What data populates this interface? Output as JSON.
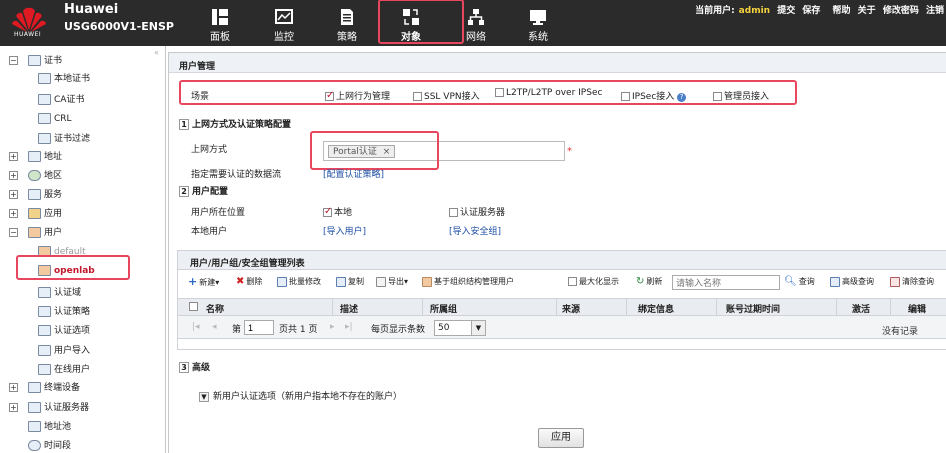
{
  "header": {
    "brand": "Huawei",
    "model": "USG6000V1-ENSP",
    "logo_text": "HUAWEI",
    "nav": [
      {
        "label": "面板",
        "icon": "dashboard-icon"
      },
      {
        "label": "监控",
        "icon": "monitor-icon"
      },
      {
        "label": "策略",
        "icon": "policy-icon"
      },
      {
        "label": "对象",
        "icon": "object-icon"
      },
      {
        "label": "网络",
        "icon": "network-icon"
      },
      {
        "label": "系统",
        "icon": "system-icon"
      }
    ],
    "current_user_label": "当前用户:",
    "current_user": "admin",
    "links": [
      "提交",
      "保存",
      "帮助",
      "关于",
      "修改密码",
      "注销"
    ]
  },
  "sidebar": {
    "items": [
      {
        "label": "证书",
        "expander": "−"
      },
      {
        "label": "本地证书"
      },
      {
        "label": "CA证书"
      },
      {
        "label": "CRL"
      },
      {
        "label": "证书过滤"
      },
      {
        "label": "地址",
        "expander": "+"
      },
      {
        "label": "地区",
        "expander": "+"
      },
      {
        "label": "服务",
        "expander": "+"
      },
      {
        "label": "应用",
        "expander": "+"
      },
      {
        "label": "用户",
        "expander": "−"
      },
      {
        "label": "default"
      },
      {
        "label": "openlab"
      },
      {
        "label": "认证域"
      },
      {
        "label": "认证策略"
      },
      {
        "label": "认证选项"
      },
      {
        "label": "用户导入"
      },
      {
        "label": "在线用户"
      },
      {
        "label": "终端设备",
        "expander": "+"
      },
      {
        "label": "认证服务器",
        "expander": "+"
      },
      {
        "label": "地址池"
      },
      {
        "label": "时间段"
      }
    ]
  },
  "main": {
    "title": "用户管理",
    "scene_label": "场景",
    "scene_options": [
      {
        "label": "上网行为管理",
        "checked": true
      },
      {
        "label": "SSL VPN接入",
        "checked": false
      },
      {
        "label": "L2TP/L2TP over IPSec",
        "checked": false
      },
      {
        "label": "IPSec接入",
        "checked": false
      },
      {
        "label": "管理员接入",
        "checked": false
      }
    ],
    "section1_num": "1",
    "section1_title": "上网方式及认证策略配置",
    "access_mode_label": "上网方式",
    "access_mode_tag": "Portal认证",
    "tag_remove": "×",
    "required_mark": "*",
    "flow_label": "指定需要认证的数据流",
    "flow_link": "[配置认证策略]",
    "section2_num": "2",
    "section2_title": "用户配置",
    "location_label": "用户所在位置",
    "location_local": "本地",
    "location_server": "认证服务器",
    "local_user_label": "本地用户",
    "import_user_link": "[导入用户]",
    "import_group_link": "[导入安全组]",
    "grid": {
      "title": "用户/用户组/安全组管理列表",
      "toolbar": [
        "新建▾",
        "删除",
        "批量修改",
        "复制",
        "导出▾",
        "基于组织结构管理用户"
      ],
      "maximize_label": "最大化显示",
      "refresh_label": "刷新",
      "search_placeholder": "请输入名称",
      "query_label": "查询",
      "advanced_label": "高级查询",
      "clear_label": "清除查询",
      "columns": [
        "名称",
        "描述",
        "所属组",
        "来源",
        "绑定信息",
        "账号过期时间",
        "激活",
        "编辑"
      ],
      "page_prefix": "第",
      "page_value": "1",
      "page_suffix": "页共 1 页",
      "per_page_label": "每页显示条数",
      "per_page_value": "50",
      "no_records": "没有记录"
    },
    "section3_num": "3",
    "section3_title": "高级",
    "new_user_option": "新用户认证选项（新用户指本地不存在的账户）",
    "apply_button": "应用"
  }
}
